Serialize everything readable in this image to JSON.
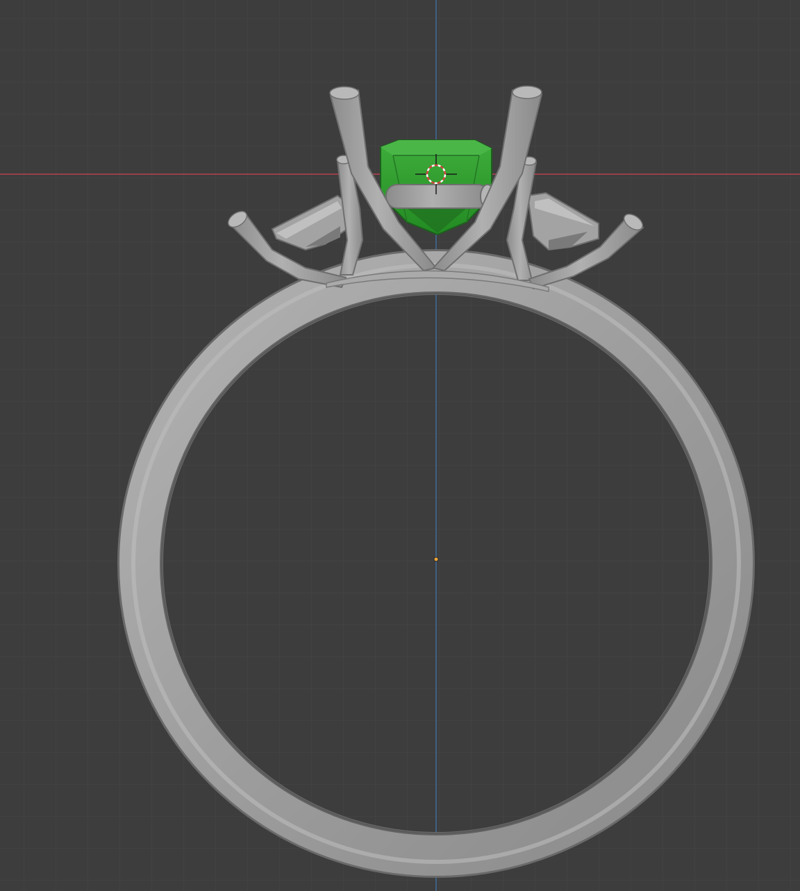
{
  "viewport": {
    "view": "front-orthographic",
    "background_color": "#3d3d3d",
    "grid": {
      "minor_color": "#474747",
      "major_color": "#515151"
    },
    "axes": {
      "x_axis_color": "#b8424f",
      "z_axis_color": "#3f78b5"
    }
  },
  "scene": {
    "object": "ring",
    "metal_color": "#9c9c9c",
    "metal_highlight": "#b4b4b4",
    "metal_shadow": "#6e6e6e",
    "gem_color": "#2f9a2f",
    "gem_dark": "#1f6f1f",
    "gem_light": "#4db84a",
    "cursor_icon": "3d-cursor-icon",
    "origin_icon": "object-origin-icon",
    "origin_color": "#f2a63b"
  }
}
